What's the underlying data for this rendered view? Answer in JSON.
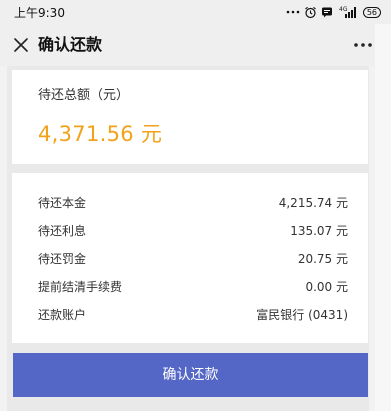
{
  "status_bar": {
    "time": "上午9:30",
    "signal_text": "4G",
    "battery": "56"
  },
  "nav": {
    "title": "确认还款"
  },
  "summary": {
    "label": "待还总额（元）",
    "amount": "4,371.56 元"
  },
  "details": [
    {
      "label": "待还本金",
      "value": "4,215.74 元"
    },
    {
      "label": "待还利息",
      "value": "135.07 元"
    },
    {
      "label": "待还罚金",
      "value": "20.75 元"
    },
    {
      "label": "提前结清手续费",
      "value": "0.00 元"
    },
    {
      "label": "还款账户",
      "value": "富民银行 (0431)"
    }
  ],
  "actions": {
    "confirm_label": "确认还款"
  },
  "colors": {
    "accent_amount": "#f2a21a",
    "button": "#5567c6"
  }
}
